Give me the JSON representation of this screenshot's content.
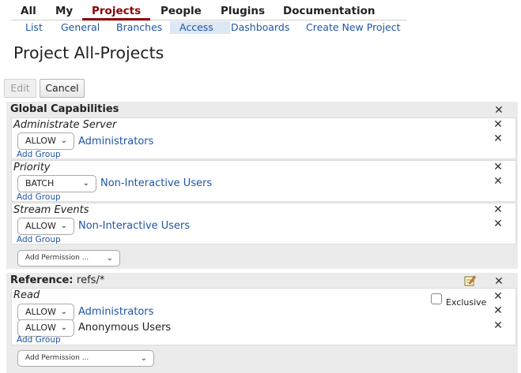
{
  "top_menu": {
    "items": [
      {
        "label": "All"
      },
      {
        "label": "My"
      },
      {
        "label": "Projects",
        "active": true
      },
      {
        "label": "People"
      },
      {
        "label": "Plugins"
      },
      {
        "label": "Documentation"
      }
    ]
  },
  "sub_menu": {
    "items": [
      {
        "label": "List"
      },
      {
        "label": "General"
      },
      {
        "label": "Branches"
      },
      {
        "label": "Access",
        "active": true
      },
      {
        "label": "Dashboards"
      },
      {
        "label": "Create New Project"
      }
    ]
  },
  "page_title": "Project All-Projects",
  "buttons": {
    "edit": "Edit",
    "cancel": "Cancel"
  },
  "global_capabilities": {
    "title": "Global Capabilities",
    "permissions": [
      {
        "name": "Administrate Server",
        "rules": [
          {
            "action": "ALLOW",
            "group": "Administrators"
          }
        ],
        "add_group": "Add Group"
      },
      {
        "name": "Priority",
        "rules": [
          {
            "action": "BATCH",
            "group": "Non-Interactive Users"
          }
        ],
        "add_group": "Add Group"
      },
      {
        "name": "Stream Events",
        "rules": [
          {
            "action": "ALLOW",
            "group": "Non-Interactive Users"
          }
        ],
        "add_group": "Add Group"
      }
    ],
    "add_permission": "Add Permission ..."
  },
  "reference": {
    "label": "Reference:",
    "value": "refs/*",
    "permissions": [
      {
        "name": "Read",
        "exclusive_label": "Exclusive",
        "exclusive_checked": false,
        "rules": [
          {
            "action": "ALLOW",
            "group": "Administrators"
          },
          {
            "action": "ALLOW",
            "group": "Anonymous Users"
          }
        ],
        "add_group": "Add Group"
      }
    ],
    "add_permission": "Add Permission ..."
  },
  "icons": {
    "close": "close-icon",
    "edit": "edit-icon",
    "dropdown": "chevron-down-icon"
  },
  "colors": {
    "active_tab": "#8b0000",
    "link": "#1f56a6",
    "active_subtab_bg": "#dce8f4",
    "section_bg": "#ebebeb"
  }
}
